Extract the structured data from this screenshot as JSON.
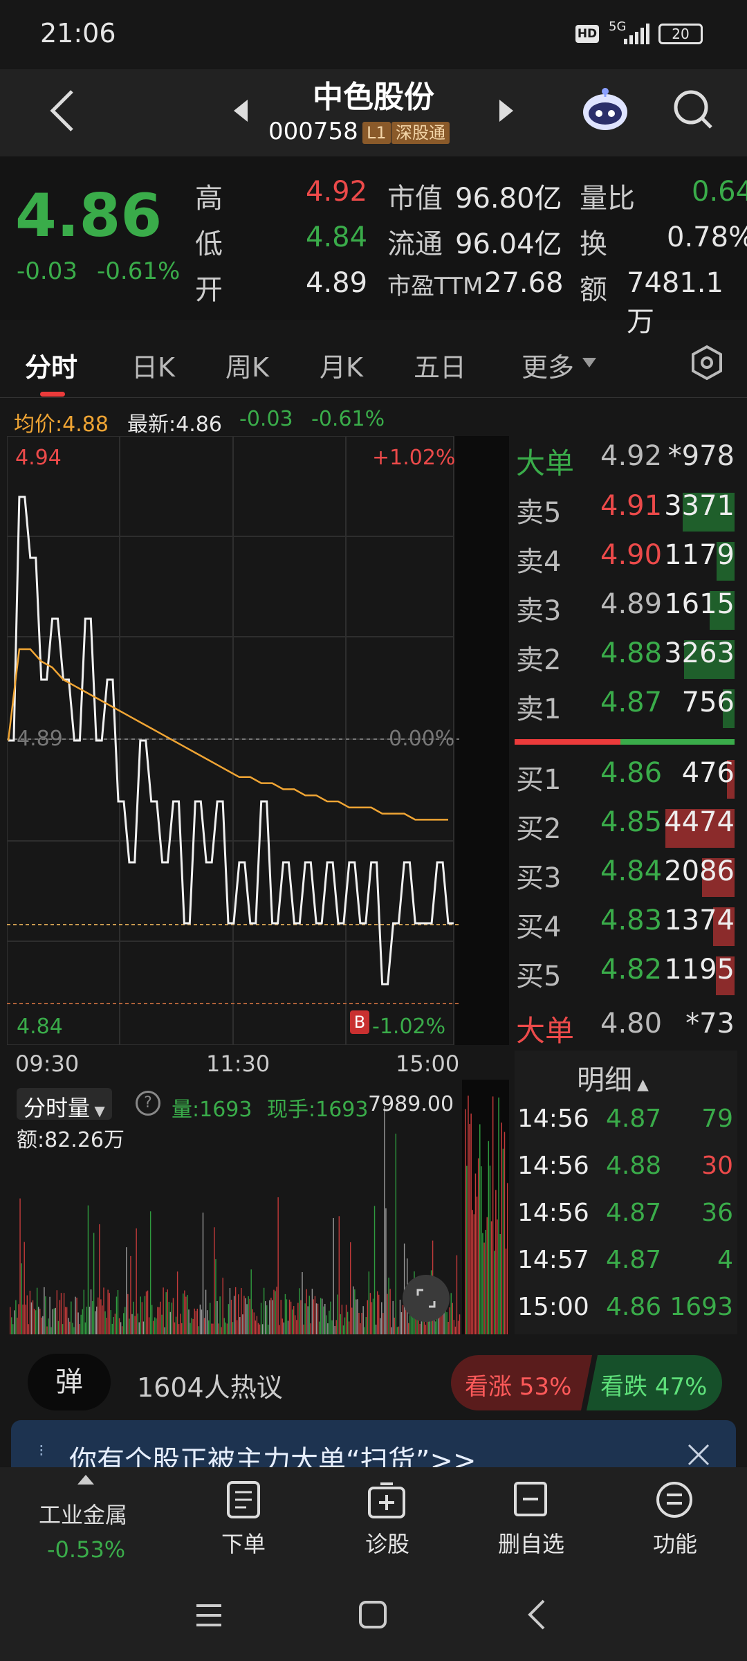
{
  "status_bar": {
    "time": "21:06",
    "network": "5G",
    "battery": "20"
  },
  "header": {
    "title": "中色股份",
    "code": "000758",
    "level_tag": "L1",
    "market_tag": "深股通"
  },
  "quote": {
    "price": "4.86",
    "change": "-0.03",
    "change_pct": "-0.61%",
    "high_label": "高",
    "high": "4.92",
    "low_label": "低",
    "low": "4.84",
    "open_label": "开",
    "open": "4.89",
    "mktcap_label": "市值",
    "mktcap": "96.80亿",
    "float_label": "流通",
    "float": "96.04亿",
    "pe_label": "市盈TTM",
    "pe": "27.68",
    "vol_ratio_label": "量比",
    "vol_ratio": "0.64",
    "turnover_label": "换",
    "turnover": "0.78%",
    "amount_label": "额",
    "amount": "7481.1万"
  },
  "tabs": [
    "分时",
    "日K",
    "周K",
    "月K",
    "五日",
    "更多"
  ],
  "chart_info": {
    "avg_label": "均价:4.88",
    "latest_label": "最新:4.86",
    "change": "-0.03",
    "change_pct": "-0.61%"
  },
  "chart_data": {
    "type": "line",
    "y_top_label": "4.94",
    "y_top_pct": "+1.02%",
    "y_mid_label": "4.89",
    "y_mid_pct": "0.00%",
    "y_bot_label": "4.84",
    "y_bot_pct": "-1.02%",
    "x_labels": [
      "09:30",
      "11:30",
      "15:00"
    ],
    "ylim": [
      4.84,
      4.94
    ],
    "price": [
      4.89,
      4.93,
      4.92,
      4.9,
      4.91,
      4.9,
      4.89,
      4.91,
      4.89,
      4.9,
      4.88,
      4.87,
      4.89,
      4.88,
      4.87,
      4.88,
      4.86,
      4.88,
      4.87,
      4.88,
      4.86,
      4.87,
      4.86,
      4.88,
      4.86,
      4.87,
      4.86,
      4.87,
      4.86,
      4.87,
      4.86,
      4.87,
      4.86,
      4.87,
      4.85,
      4.86,
      4.87,
      4.86,
      4.86,
      4.87,
      4.86
    ],
    "avg": [
      4.89,
      4.905,
      4.905,
      4.903,
      4.902,
      4.9,
      4.899,
      4.898,
      4.897,
      4.896,
      4.895,
      4.894,
      4.893,
      4.892,
      4.891,
      4.89,
      4.889,
      4.888,
      4.887,
      4.886,
      4.885,
      4.884,
      4.884,
      4.883,
      4.883,
      4.882,
      4.882,
      4.881,
      4.881,
      4.88,
      4.88,
      4.879,
      4.879,
      4.879,
      4.878,
      4.878,
      4.878,
      4.877,
      4.877,
      4.877,
      4.877
    ],
    "marker": "B"
  },
  "volume": {
    "selector": "分时量",
    "help": "?",
    "vol_label": "量:1693",
    "now_label": "现手:1693",
    "max_label": "7989.00",
    "amount_label": "额:82.26万"
  },
  "order_book": {
    "big_sell_label": "大单",
    "big_sell_price": "4.92",
    "big_sell_vol": "*978",
    "asks": [
      {
        "label": "卖5",
        "price": "4.91",
        "vol": "3371",
        "fill": 0.75,
        "color": "red"
      },
      {
        "label": "卖4",
        "price": "4.90",
        "vol": "1179",
        "fill": 0.26,
        "color": "red"
      },
      {
        "label": "卖3",
        "price": "4.89",
        "vol": "1615",
        "fill": 0.36,
        "color": "grey"
      },
      {
        "label": "卖2",
        "price": "4.88",
        "vol": "3263",
        "fill": 0.73,
        "color": "green"
      },
      {
        "label": "卖1",
        "price": "4.87",
        "vol": "756",
        "fill": 0.17,
        "color": "green"
      }
    ],
    "bids": [
      {
        "label": "买1",
        "price": "4.86",
        "vol": "476",
        "fill": 0.11,
        "color": "green"
      },
      {
        "label": "买2",
        "price": "4.85",
        "vol": "4474",
        "fill": 1.0,
        "color": "green"
      },
      {
        "label": "买3",
        "price": "4.84",
        "vol": "2086",
        "fill": 0.47,
        "color": "green"
      },
      {
        "label": "买4",
        "price": "4.83",
        "vol": "1374",
        "fill": 0.31,
        "color": "green"
      },
      {
        "label": "买5",
        "price": "4.82",
        "vol": "1195",
        "fill": 0.27,
        "color": "green"
      }
    ],
    "big_buy_label": "大单",
    "big_buy_price": "4.80",
    "big_buy_vol": "*73"
  },
  "ticks": {
    "title": "明细",
    "rows": [
      {
        "time": "14:56",
        "price": "4.87",
        "vol": "79",
        "color": "green"
      },
      {
        "time": "14:56",
        "price": "4.88",
        "vol": "30",
        "color": "red"
      },
      {
        "time": "14:56",
        "price": "4.87",
        "vol": "36",
        "color": "green"
      },
      {
        "time": "14:57",
        "price": "4.87",
        "vol": "4",
        "color": "green"
      },
      {
        "time": "15:00",
        "price": "4.86",
        "vol": "1693",
        "color": "green"
      }
    ]
  },
  "discussion": {
    "danmu": "弹",
    "count_label": "1604人热议",
    "up_label": "看涨 53%",
    "down_label": "看跌 47%",
    "up_pct": 53
  },
  "banner": {
    "text": "你有个股正被主力大单“扫货”>>"
  },
  "bottom_nav": {
    "sector": "工业金属",
    "sector_pct": "-0.53%",
    "items": [
      "下单",
      "诊股",
      "删自选",
      "功能"
    ]
  }
}
